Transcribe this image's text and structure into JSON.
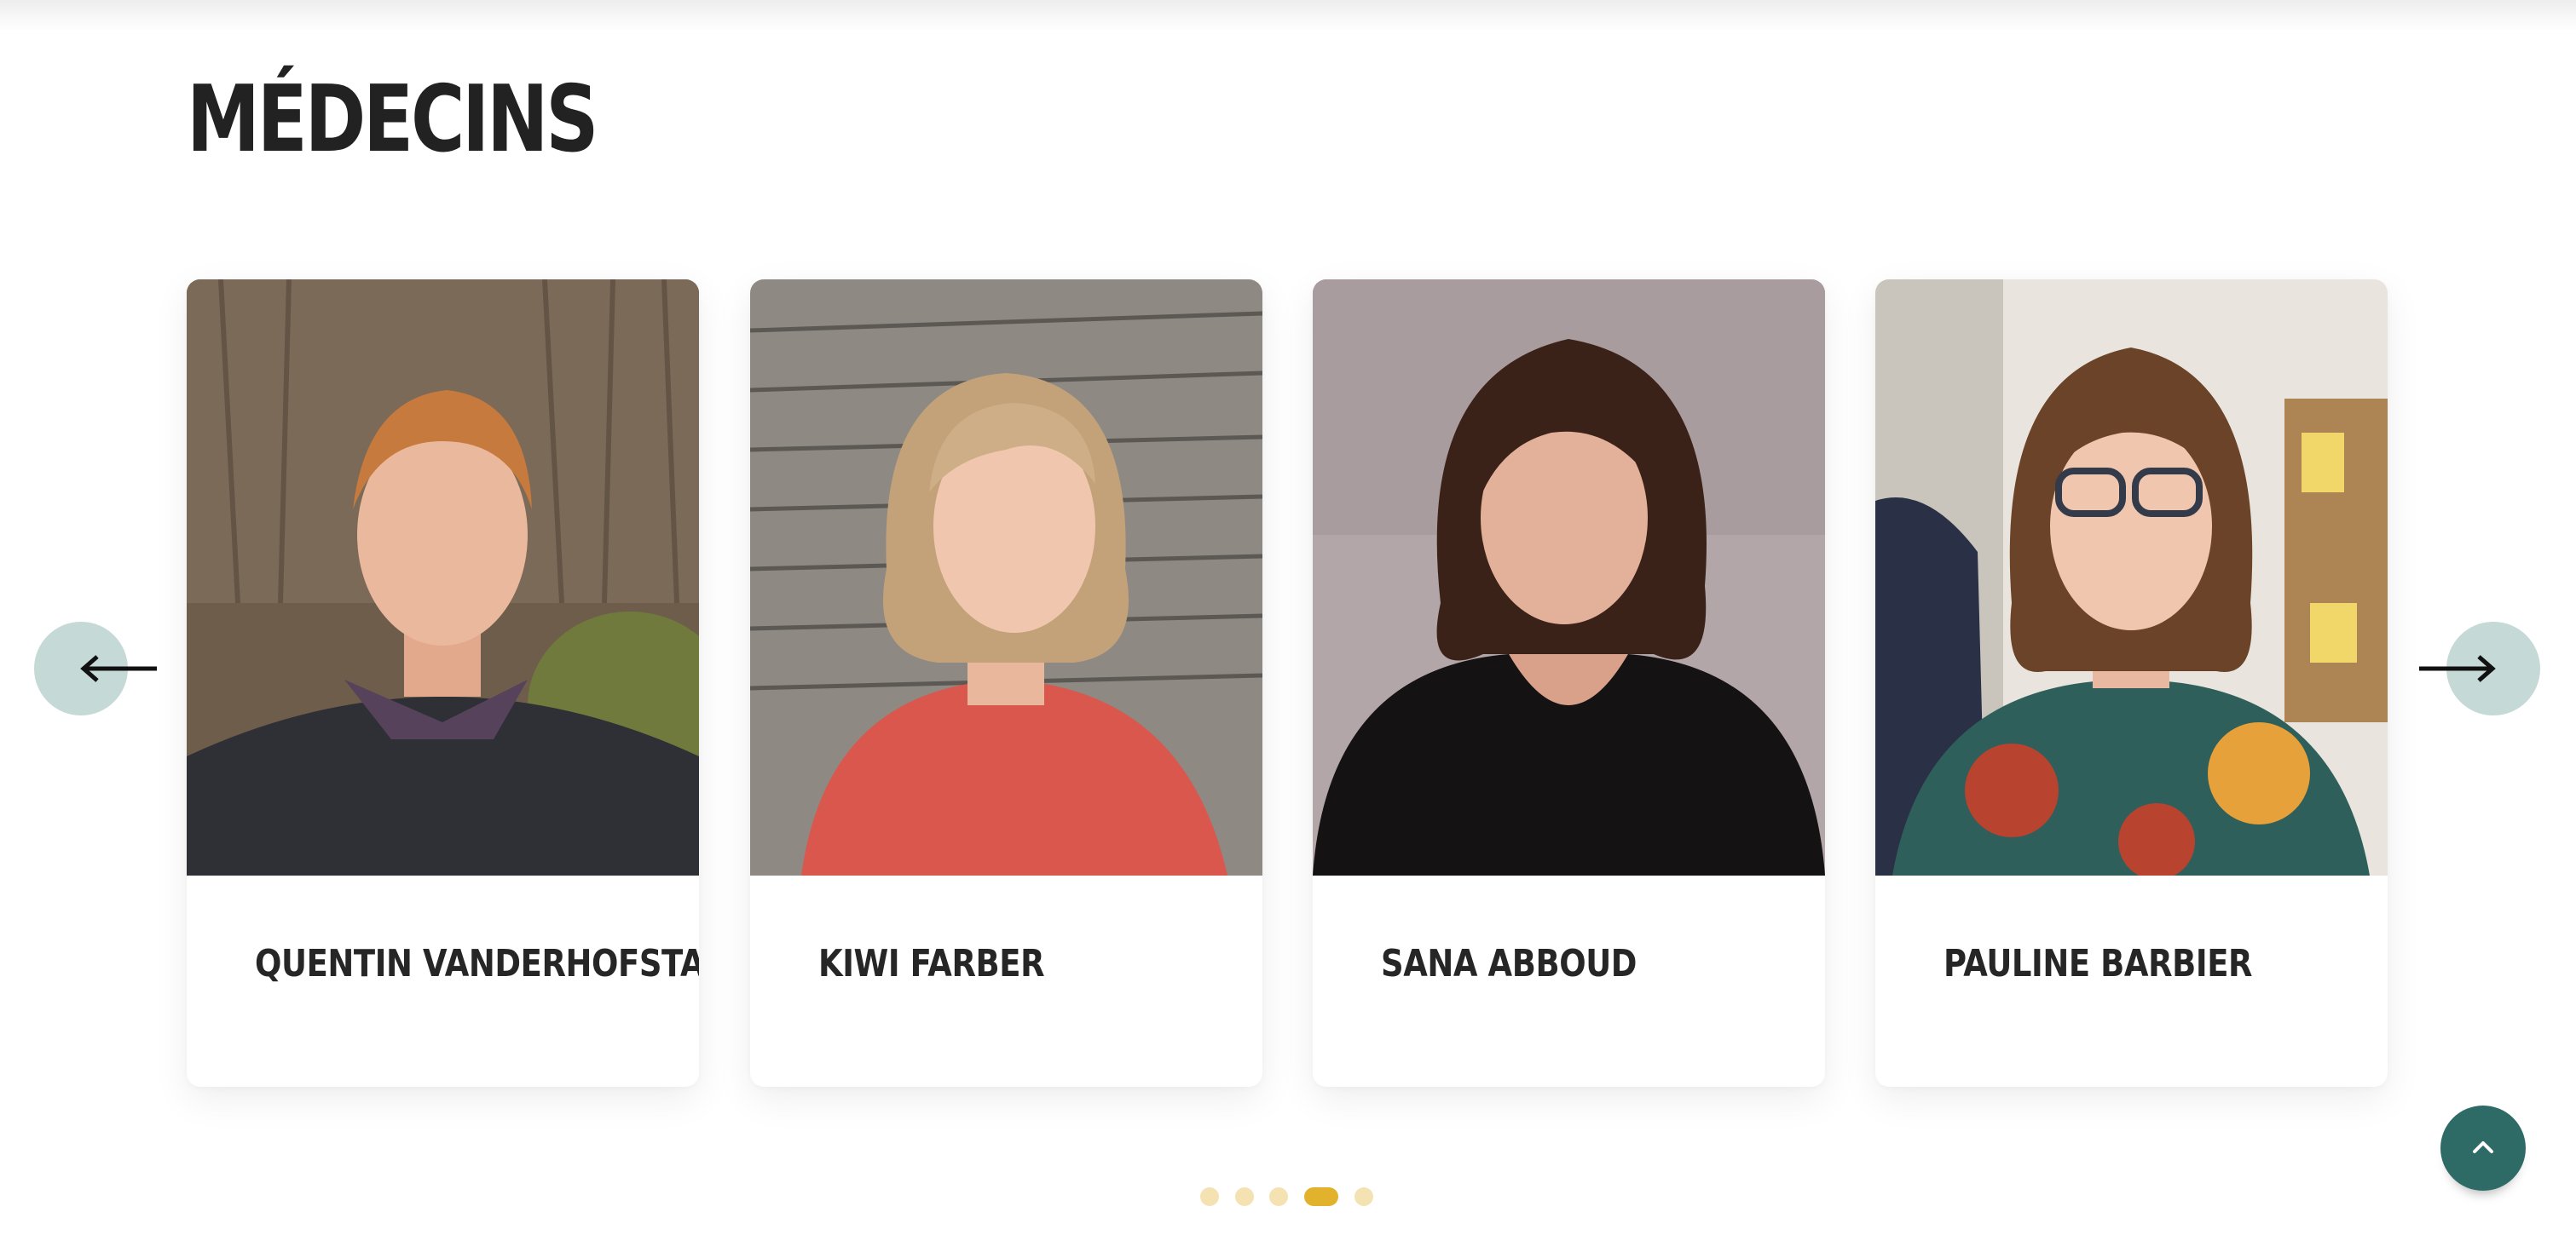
{
  "section": {
    "title": "MÉDECINS"
  },
  "doctors": [
    {
      "name": "QUENTIN VANDERHOFSTADT"
    },
    {
      "name": "KIWI FARBER"
    },
    {
      "name": "SANA ABBOUD"
    },
    {
      "name": "PAULINE BARBIER"
    }
  ],
  "carousel": {
    "prev_icon": "arrow-left-icon",
    "next_icon": "arrow-right-icon",
    "page_count": 5,
    "active_page": 4
  },
  "back_to_top": {
    "icon": "chevron-up-icon"
  },
  "colors": {
    "accent_teal": "#2f6b66",
    "arrow_button_bg": "#c5d9d6",
    "dot_active": "#e3b22d",
    "dot_inactive": "#f5e2b2"
  }
}
